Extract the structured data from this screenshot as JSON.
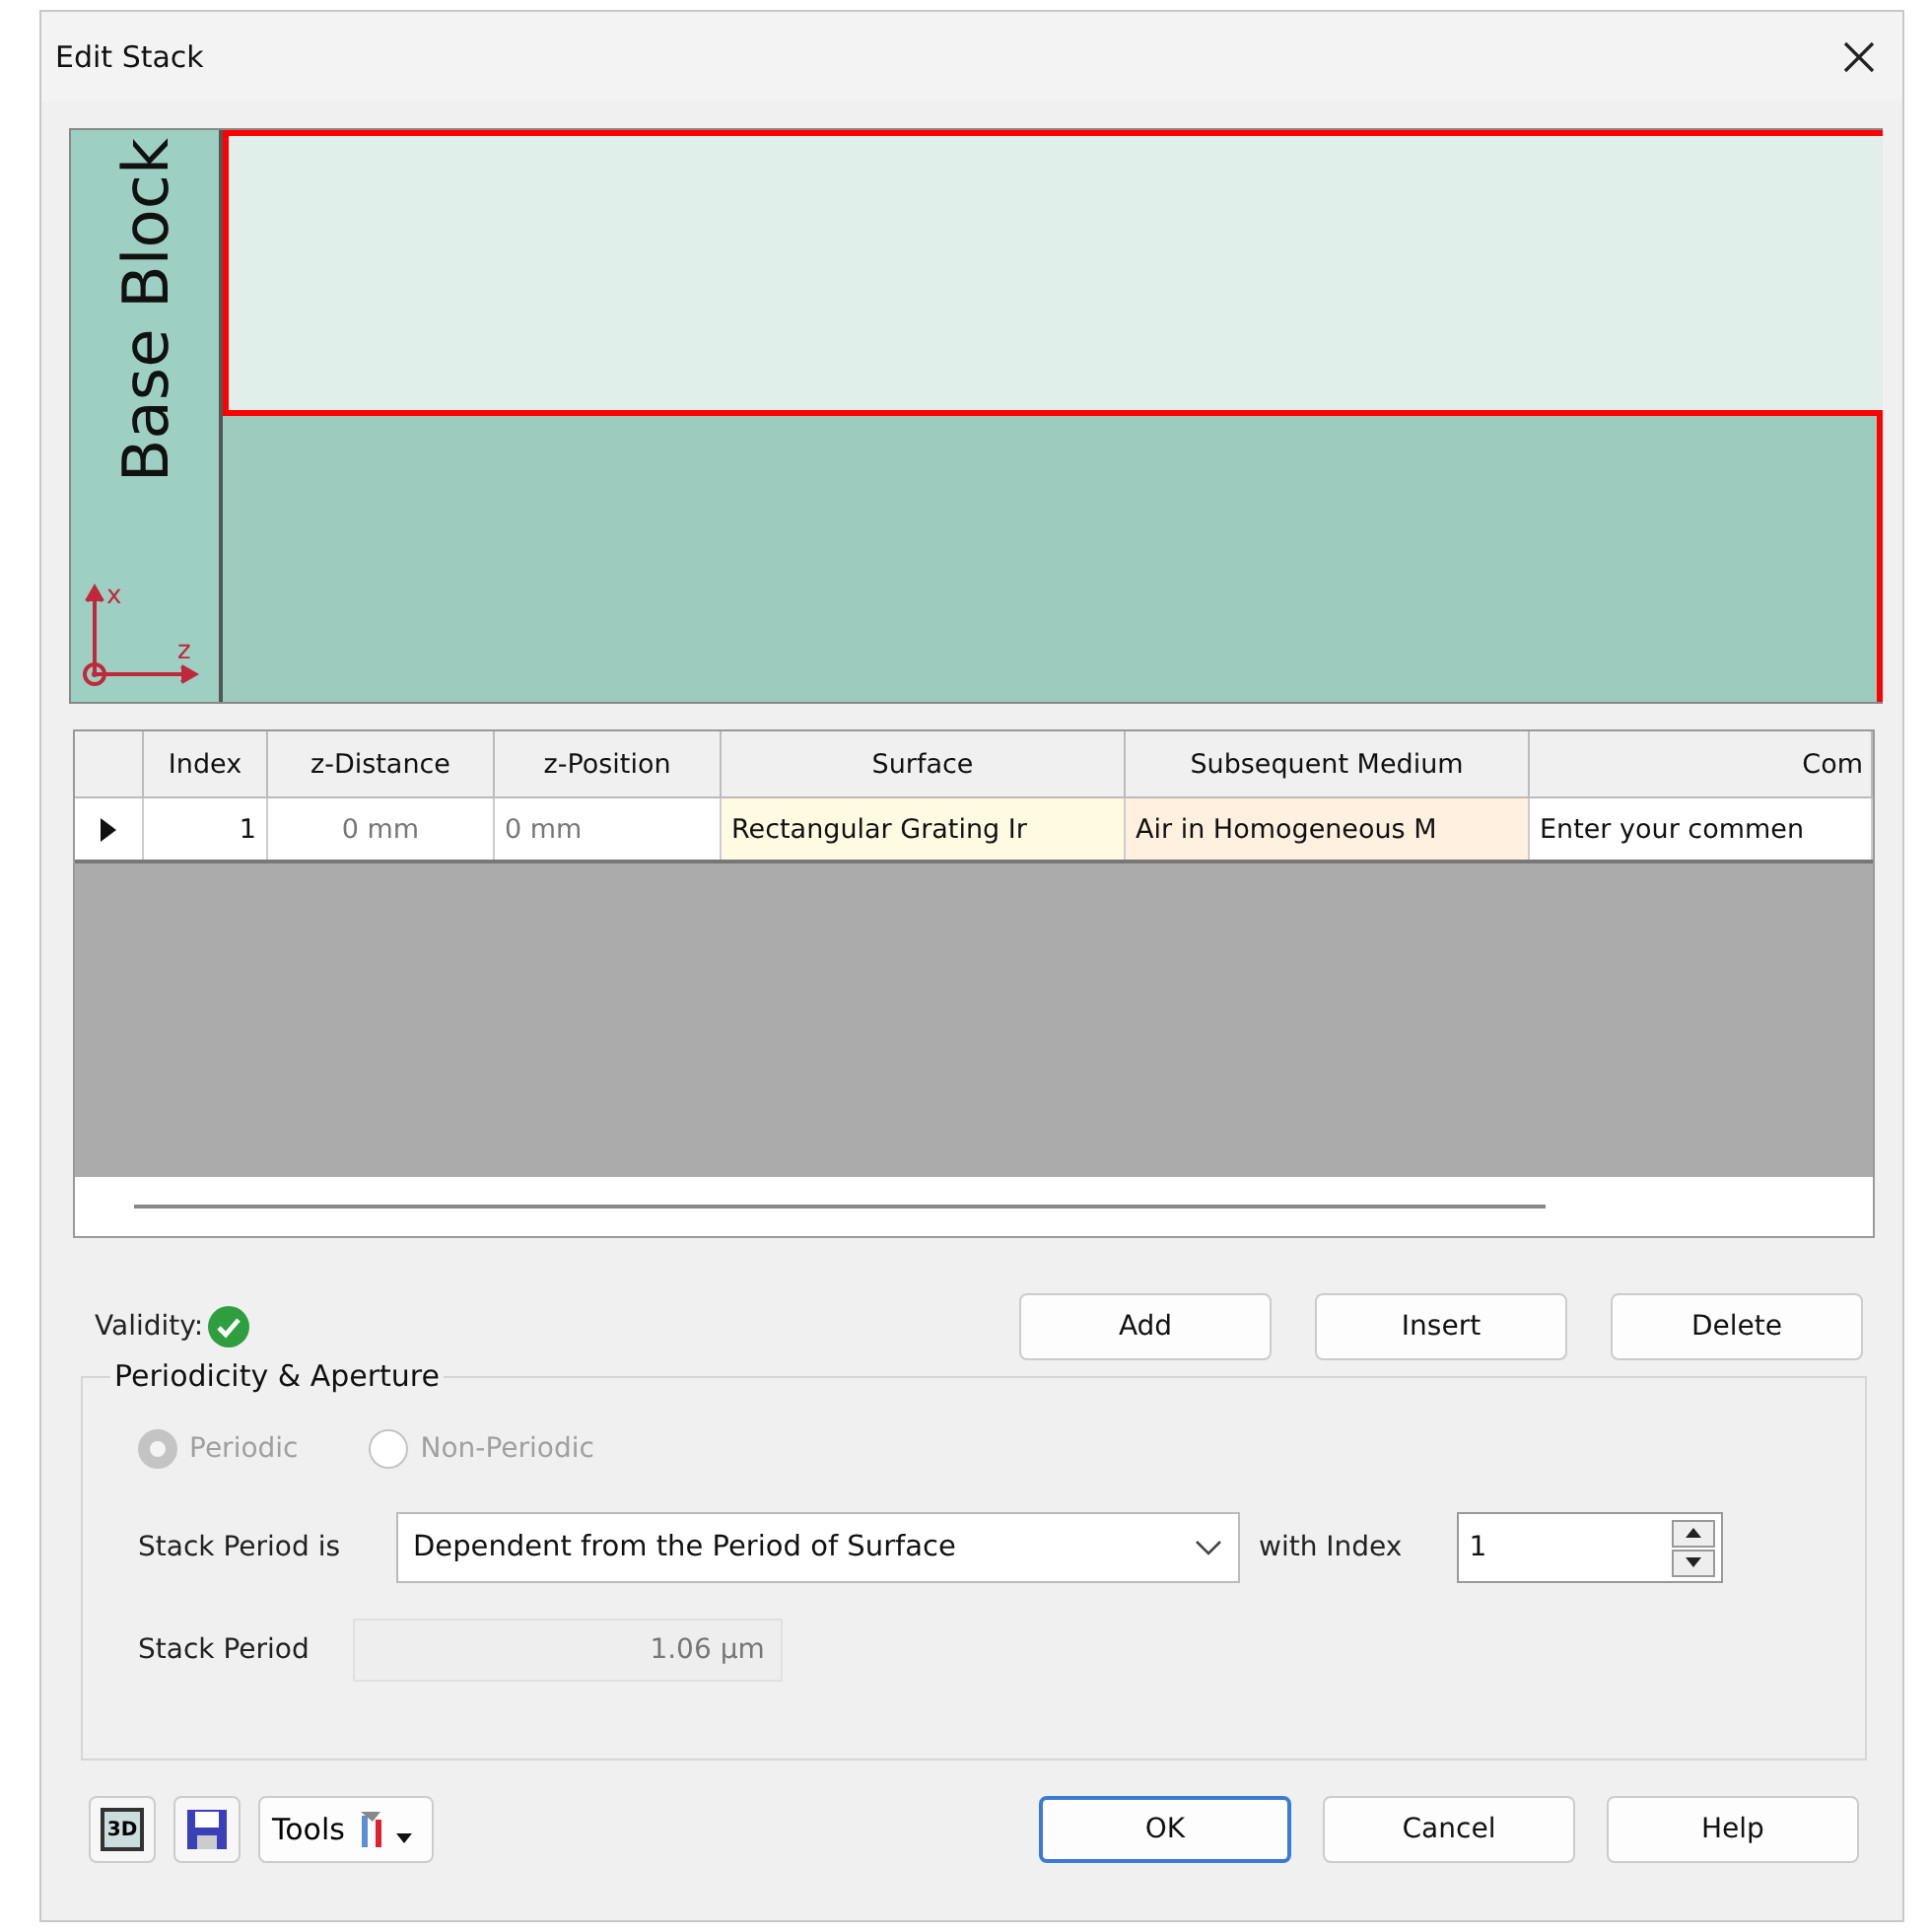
{
  "window": {
    "title": "Edit Stack"
  },
  "preview": {
    "block_label": "Base Block",
    "axis_x": "x",
    "axis_z": "z"
  },
  "table": {
    "columns": [
      "Index",
      "z-Distance",
      "z-Position",
      "Surface",
      "Subsequent Medium",
      "Com"
    ],
    "rows": [
      {
        "selected": true,
        "cells": [
          "1",
          "0 mm",
          "0 mm",
          "Rectangular Grating Ir",
          "Air in Homogeneous M",
          "Enter your commen"
        ]
      }
    ]
  },
  "validity": {
    "label": "Validity:",
    "valid": true
  },
  "row_buttons": [
    "Add",
    "Insert",
    "Delete"
  ],
  "periodicity": {
    "title": "Periodicity & Aperture",
    "disabled": true,
    "options": [
      {
        "label": "Periodic",
        "selected": true
      },
      {
        "label": "Non-Periodic",
        "selected": false
      }
    ],
    "period_is_label": "Stack Period is",
    "period_is_value": "Dependent from the Period of Surface",
    "index_label": "with Index",
    "index_value": "1",
    "period_label": "Stack Period",
    "period_value": "1.06 µm"
  },
  "footer": {
    "view_3d": "3D",
    "tools": "Tools",
    "buttons": [
      {
        "label": "OK",
        "default": true
      },
      {
        "label": "Cancel",
        "default": false
      },
      {
        "label": "Help",
        "default": false
      }
    ]
  }
}
